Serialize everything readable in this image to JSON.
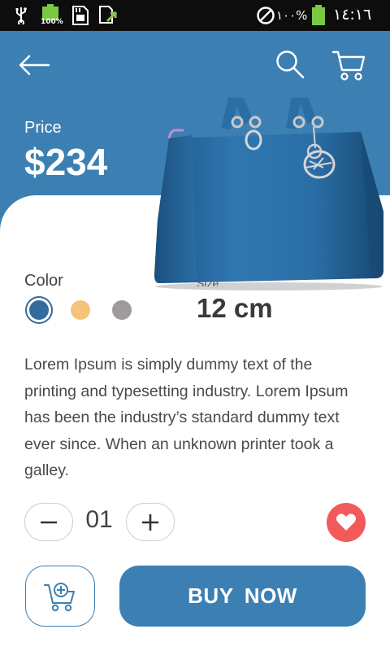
{
  "status_bar": {
    "battery_badge": "100%",
    "battery_percent": "١٠٠%",
    "time": "١٤:١٦",
    "icons": [
      "usb-icon",
      "battery-icon",
      "sd-card-icon",
      "screenshot-icon",
      "no-disturb-icon",
      "battery-full-icon"
    ]
  },
  "header": {
    "icons": [
      "back-arrow-icon",
      "search-icon",
      "cart-icon"
    ]
  },
  "product": {
    "price_label": "Price",
    "price": "$234",
    "color_label": "Color",
    "colors": [
      "#346b9b",
      "#f7c37c",
      "#a09a9a"
    ],
    "selected_color_index": 0,
    "size_label": "Size",
    "size_value": "12 cm",
    "description": "Lorem Ipsum is simply dummy text of the printing and typesetting industry. Lorem Ipsum has been the industry’s standard dummy text ever since. When an unknown printer took a galley."
  },
  "quantity": {
    "value": "01"
  },
  "actions": {
    "buy_label": "BUY  NOW"
  },
  "theme": {
    "accent": "#3c80b3",
    "favorite": "#f25a5a"
  }
}
